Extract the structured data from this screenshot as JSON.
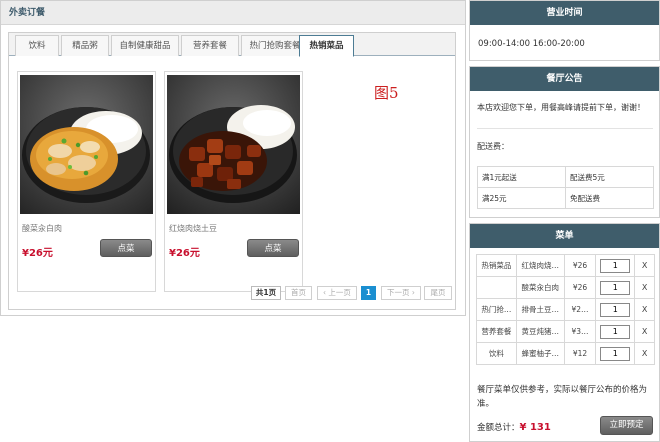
{
  "order_panel": {
    "title": "外卖订餐",
    "tabs": [
      "饮料",
      "精品粥",
      "自制健康甜品",
      "营养套餐",
      "热门抢购套餐",
      "热销菜品"
    ],
    "active_tab": "热销菜品",
    "products": [
      {
        "name": "酸菜汆白肉",
        "price": "¥26元",
        "button": "点菜"
      },
      {
        "name": "红烧肉烧土豆",
        "price": "¥26元",
        "button": "点菜"
      }
    ],
    "figure_label": "图5",
    "pagination": {
      "total": "共1页",
      "first": "首页",
      "prev": "‹ 上一页",
      "current": "1",
      "next": "下一页 ›",
      "last": "尾页"
    }
  },
  "hours": {
    "title": "营业时间",
    "text": "09:00-14:00 16:00-20:00"
  },
  "notice": {
    "title": "餐厅公告",
    "text": "本店欢迎您下单，用餐高峰请提前下单，谢谢！",
    "fee_title": "配送费：",
    "fees": [
      {
        "condition": "满1元起送",
        "fee": "配送费5元"
      },
      {
        "condition": "满25元",
        "fee": "免配送费"
      }
    ]
  },
  "menu": {
    "title": "菜单",
    "items": [
      {
        "category": "热销菜品",
        "name": "红烧肉烧…",
        "price": "¥26",
        "qty": "1",
        "remove": "X"
      },
      {
        "category": "",
        "name": "酸菜汆白肉",
        "price": "¥26",
        "qty": "1",
        "remove": "X"
      },
      {
        "category": "热门抢…",
        "name": "排骨土豆…",
        "price": "¥2…",
        "qty": "1",
        "remove": "X"
      },
      {
        "category": "营养套餐",
        "name": "黄豆炖猪…",
        "price": "¥3…",
        "qty": "1",
        "remove": "X"
      },
      {
        "category": "饮料",
        "name": "蜂蜜柚子…",
        "price": "¥12",
        "qty": "1",
        "remove": "X"
      }
    ],
    "note": "餐厅菜单仅供参考，实际以餐厅公布的价格为准。",
    "total_label": "金额总计：",
    "total_value": "¥ 131",
    "submit": "立即预定"
  },
  "colors": {
    "header_bg": "#3f5d6b",
    "price_red": "#c8102e",
    "free_orange": "#ff6600",
    "pager_blue": "#1b8fd1",
    "figure_red": "#cc1f1f"
  }
}
